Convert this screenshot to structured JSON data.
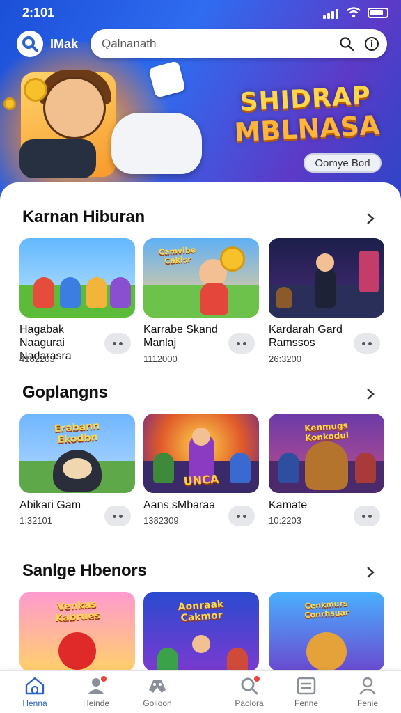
{
  "status_bar": {
    "time": "2:101"
  },
  "header": {
    "brand": "IMak",
    "search_placeholder": "Qalnanath"
  },
  "hero": {
    "title_line1": "SHIDRAP",
    "title_line2": "MBLNASA",
    "button_label": "Oomye Borl"
  },
  "sections": [
    {
      "title": "Karnan Hiburan",
      "items": [
        {
          "title": "Hagabak Naagurai Nadarasra",
          "meta": "4182203"
        },
        {
          "title": "Karrabe Skand Manlaj",
          "meta": "1112000"
        },
        {
          "title": "Kardarah Gard Ramssos",
          "meta": "26:3200"
        }
      ]
    },
    {
      "title": "Goplangns",
      "items": [
        {
          "title": "Abikari Gam",
          "meta": "1:32101"
        },
        {
          "title": "Aans sMbaraa",
          "meta": "1382309"
        },
        {
          "title": "Kamate",
          "meta": "10:2203"
        }
      ]
    },
    {
      "title": "Sanlge Hbenors",
      "items": [
        {
          "title": "",
          "meta": ""
        },
        {
          "title": "",
          "meta": ""
        },
        {
          "title": "",
          "meta": ""
        }
      ]
    }
  ],
  "thumb_text": {
    "s1c2": "Camvibe Cakisr",
    "s2c1": "Erabann Ekodbn",
    "s2c2": "UNCA",
    "s2c3": "Kenmugs Konkodul",
    "s3c1": "Venkas Kabrues",
    "s3c2": "Aonraak Cakmor",
    "s3c3": "Cenkmurs Conrhsuar"
  },
  "nav": [
    {
      "label": "Henna",
      "icon": "home-icon",
      "active": true
    },
    {
      "label": "Heinde",
      "icon": "profile-icon"
    },
    {
      "label": "Goiloon",
      "icon": "gamepad-icon"
    },
    {
      "label": "Paolora",
      "icon": "search-icon"
    },
    {
      "label": "Fenne",
      "icon": "list-icon"
    },
    {
      "label": "Fenie",
      "icon": "user-icon"
    }
  ],
  "colors": {
    "accent": "#2e63c9",
    "hero_blue": "#2f6cf0",
    "badge_red": "#e7453f"
  }
}
